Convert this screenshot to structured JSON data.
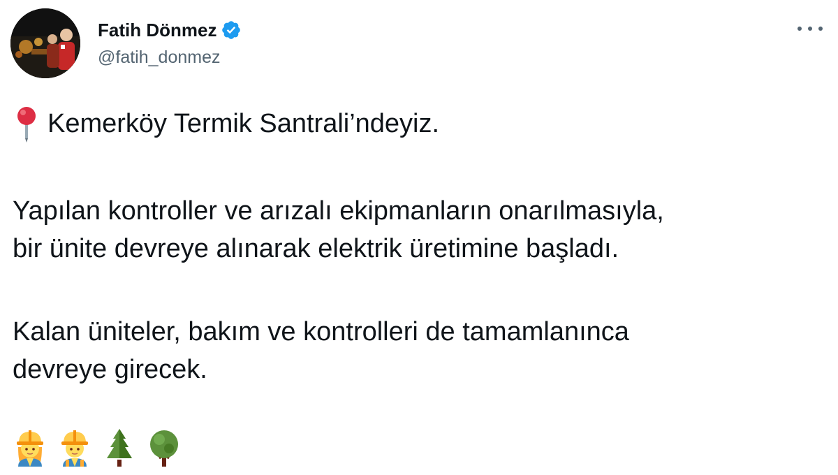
{
  "tweet": {
    "author": {
      "display_name": "Fatih Dönmez",
      "handle": "@fatih_donmez",
      "verified": true
    },
    "body": {
      "line1": "Kemerköy Termik Santrali’ndeyiz.",
      "para2_line1": "Yapılan kontroller ve arızalı ekipmanların onarılmasıyla,",
      "para2_line2": "bir ünite devreye alınarak elektrik üretimine başladı.",
      "para3_line1": "Kalan üniteler, bakım ve kontrolleri de tamamlanınca",
      "para3_line2": "devreye girecek."
    },
    "emojis": [
      "woman-construction-worker-icon",
      "man-construction-worker-icon",
      "evergreen-tree-icon",
      "deciduous-tree-icon"
    ],
    "colors": {
      "text": "#0f1419",
      "secondary": "#536471",
      "verified_blue": "#1d9bf0"
    }
  }
}
